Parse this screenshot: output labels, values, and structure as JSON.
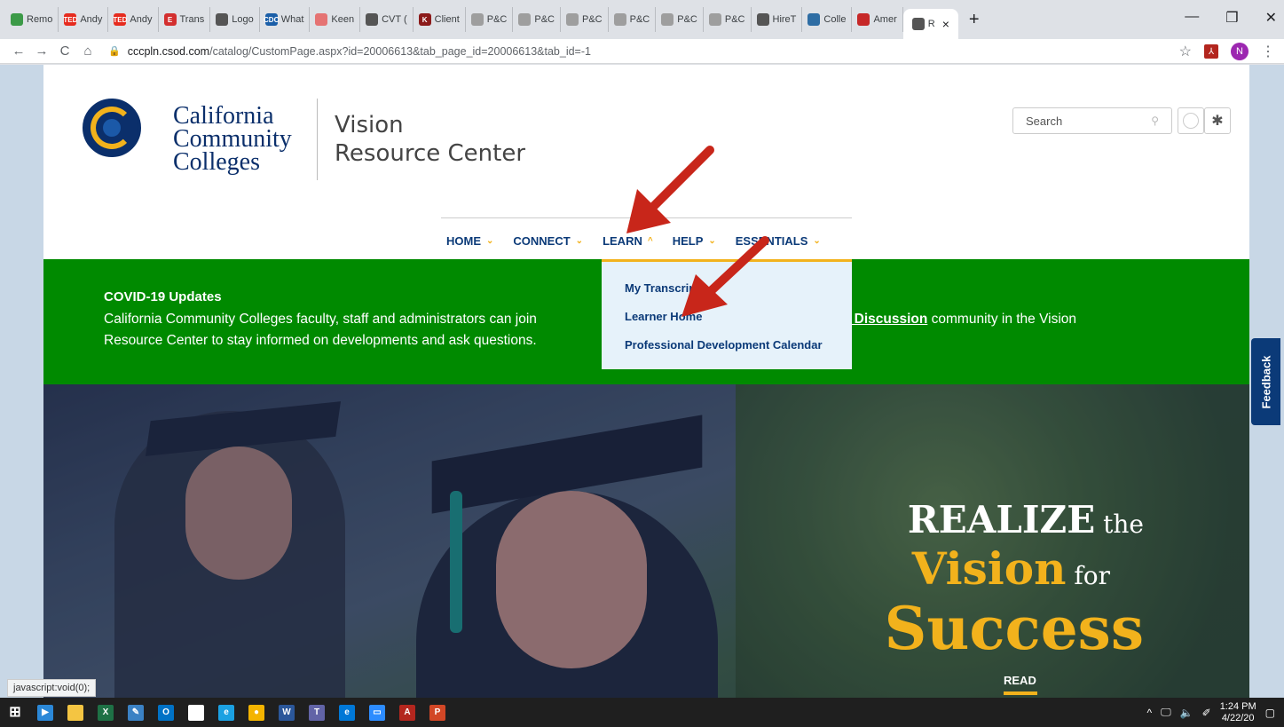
{
  "browser": {
    "tabs": [
      {
        "label": "Remo",
        "fav_color": "#3c9a48",
        "fav_glyph": ""
      },
      {
        "label": "Andy",
        "fav_color": "#e62b1e",
        "fav_glyph": "TED"
      },
      {
        "label": "Andy",
        "fav_color": "#e62b1e",
        "fav_glyph": "TED"
      },
      {
        "label": "Trans",
        "fav_color": "#d32f2f",
        "fav_glyph": "E"
      },
      {
        "label": "Logo",
        "fav_color": "#555555",
        "fav_glyph": ""
      },
      {
        "label": "What",
        "fav_color": "#1a5ea8",
        "fav_glyph": "CDC"
      },
      {
        "label": "Keen",
        "fav_color": "#e57373",
        "fav_glyph": ""
      },
      {
        "label": "CVT (",
        "fav_color": "#555555",
        "fav_glyph": ""
      },
      {
        "label": "Client",
        "fav_color": "#8b1a1a",
        "fav_glyph": "K"
      },
      {
        "label": "P&C",
        "fav_color": "#9e9e9e",
        "fav_glyph": ""
      },
      {
        "label": "P&C",
        "fav_color": "#9e9e9e",
        "fav_glyph": ""
      },
      {
        "label": "P&C",
        "fav_color": "#9e9e9e",
        "fav_glyph": ""
      },
      {
        "label": "P&C",
        "fav_color": "#9e9e9e",
        "fav_glyph": ""
      },
      {
        "label": "P&C",
        "fav_color": "#9e9e9e",
        "fav_glyph": ""
      },
      {
        "label": "P&C",
        "fav_color": "#9e9e9e",
        "fav_glyph": ""
      },
      {
        "label": "HireT",
        "fav_color": "#555555",
        "fav_glyph": ""
      },
      {
        "label": "Colle",
        "fav_color": "#2e6da4",
        "fav_glyph": ""
      },
      {
        "label": "Amer",
        "fav_color": "#c62828",
        "fav_glyph": ""
      }
    ],
    "active_tab": {
      "label": "R",
      "close": "×"
    },
    "new_tab": "+",
    "window_controls": {
      "minimize": "—",
      "maximize": "❐",
      "close": "✕"
    },
    "nav": {
      "back": "←",
      "forward": "→",
      "reload": "C",
      "home": "⌂"
    },
    "url": {
      "lock": "🔒",
      "host": "cccpln.csod.com",
      "path": "/catalog/CustomPage.aspx?id=20006613&tab_page_id=20006613&tab_id=-1"
    },
    "star": "☆",
    "profile_initial": "N",
    "menu": "⋮",
    "status_text": "javascript:void(0);"
  },
  "site": {
    "logo_text": [
      "California",
      "Community",
      "Colleges"
    ],
    "product_name": [
      "Vision",
      "Resource Center"
    ],
    "search": {
      "placeholder": "Search",
      "icon": "magnifier-icon"
    },
    "gear": "✱",
    "nav": [
      {
        "label": "HOME",
        "chev": "⌄"
      },
      {
        "label": "CONNECT",
        "chev": "⌄"
      },
      {
        "label": "LEARN",
        "chev": "^"
      },
      {
        "label": "HELP",
        "chev": "⌄"
      },
      {
        "label": "ESSENTIALS",
        "chev": "⌄"
      }
    ],
    "learn_menu": [
      "My Transcript",
      "Learner Home",
      "Professional Development Calendar"
    ],
    "covid": {
      "title": "COVID-19 Updates",
      "text_before": "California Community Colleges faculty, staff and administrators can join",
      "link_text": "ls and Discussion",
      "text_after": " community in the Vision",
      "text_line2": "Resource Center to stay informed on developments and ask questions."
    },
    "hero": {
      "word_realize": "REALIZE",
      "word_the": " the",
      "word_vision": "Vision",
      "word_for": " for",
      "word_success": "Success",
      "read": "READ"
    },
    "feedback": "Feedback"
  },
  "taskbar": {
    "icons": [
      {
        "name": "windows-start-icon",
        "color": "#ffffff",
        "glyph": "⊞"
      },
      {
        "name": "media-player-icon",
        "color": "#2b88d8",
        "glyph": "▶"
      },
      {
        "name": "file-explorer-icon",
        "color": "#f4c542",
        "glyph": ""
      },
      {
        "name": "excel-icon",
        "color": "#1e7145",
        "glyph": "X"
      },
      {
        "name": "pen-app-icon",
        "color": "#3b82c4",
        "glyph": "✎"
      },
      {
        "name": "outlook-icon",
        "color": "#0072c6",
        "glyph": "O"
      },
      {
        "name": "store-icon",
        "color": "#ffffff",
        "glyph": "🛍"
      },
      {
        "name": "ie-icon",
        "color": "#1ba1e2",
        "glyph": "e"
      },
      {
        "name": "chrome-icon",
        "color": "#f4b400",
        "glyph": "●"
      },
      {
        "name": "word-icon",
        "color": "#2b579a",
        "glyph": "W"
      },
      {
        "name": "teams-icon",
        "color": "#6264a7",
        "glyph": "T"
      },
      {
        "name": "edge-icon",
        "color": "#0078d7",
        "glyph": "e"
      },
      {
        "name": "zoom-icon",
        "color": "#2d8cff",
        "glyph": "▭"
      },
      {
        "name": "acrobat-icon",
        "color": "#b3261e",
        "glyph": "A"
      },
      {
        "name": "powerpoint-icon",
        "color": "#d24726",
        "glyph": "P"
      }
    ],
    "tray": {
      "chevron": "^",
      "network": "🖵",
      "volume": "🔈",
      "pen": "✐"
    },
    "clock": {
      "time": "1:24 PM",
      "date": "4/22/20"
    },
    "notifications": "▢"
  },
  "colors": {
    "brand_navy": "#0b3a78",
    "brand_gold": "#f2b21c",
    "covid_green": "#008a00",
    "arrow_red": "#c8261a"
  }
}
